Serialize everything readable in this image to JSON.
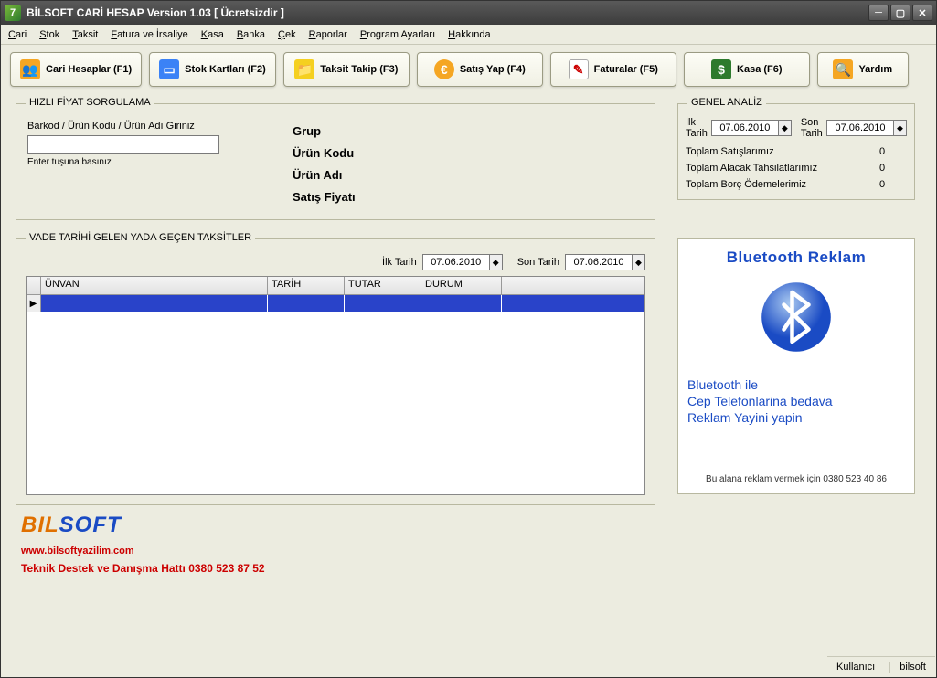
{
  "title": "BİLSOFT CARİ HESAP Version 1.03   [ Ücretsizdir ]",
  "menu": [
    "Cari",
    "Stok",
    "Taksit",
    "Fatura ve İrsaliye",
    "Kasa",
    "Banka",
    "Çek",
    "Raporlar",
    "Program Ayarları",
    "Hakkında"
  ],
  "toolbar": {
    "cari": "Cari Hesaplar (F1)",
    "stok": "Stok Kartları (F2)",
    "taksit": "Taksit Takip (F3)",
    "satis": "Satış Yap (F4)",
    "fatura": "Faturalar (F5)",
    "kasa": "Kasa (F6)",
    "yardim": "Yardım"
  },
  "price": {
    "legend": "HIZLI FİYAT SORGULAMA",
    "input_label": "Barkod / Ürün Kodu / Ürün Adı Giriniz",
    "hint": "Enter tuşuna basınız",
    "labels": {
      "grup": "Grup",
      "kod": "Ürün Kodu",
      "ad": "Ürün Adı",
      "fiyat": "Satış Fiyatı"
    }
  },
  "analysis": {
    "legend": "GENEL ANALİZ",
    "ilk": "İlk Tarih",
    "son": "Son Tarih",
    "date1": "07.06.2010",
    "date2": "07.06.2010",
    "rows": [
      {
        "label": "Toplam Satışlarımız",
        "value": "0"
      },
      {
        "label": "Toplam Alacak Tahsilatlarımız",
        "value": "0"
      },
      {
        "label": "Toplam Borç Ödemelerimiz",
        "value": "0"
      }
    ]
  },
  "installments": {
    "legend": "VADE TARİHİ GELEN YADA GEÇEN TAKSİTLER",
    "ilk": "İlk Tarih",
    "son": "Son Tarih",
    "date1": "07.06.2010",
    "date2": "07.06.2010",
    "columns": [
      "ÜNVAN",
      "TARİH",
      "TUTAR",
      "DURUM"
    ]
  },
  "ad": {
    "title": "Bluetooth Reklam",
    "line1": "Bluetooth ile",
    "line2": "Cep Telefonlarina bedava",
    "line3": "Reklam Yayini yapin",
    "footer": "Bu alana reklam vermek için 0380 523 40 86"
  },
  "footer": {
    "url": "www.bilsoftyazilim.com",
    "support": "Teknik Destek ve Danışma Hattı 0380 523 87 52"
  },
  "statusbar": {
    "user_label": "Kullanıcı",
    "user": "bilsoft"
  }
}
